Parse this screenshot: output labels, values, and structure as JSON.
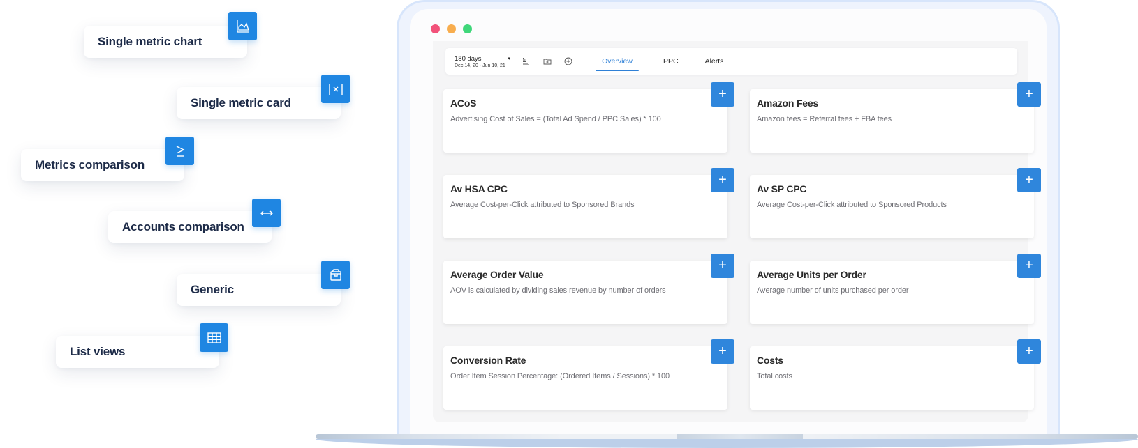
{
  "widget_types": [
    {
      "label": "Single metric chart",
      "icon": "area-chart-icon"
    },
    {
      "label": "Single metric card",
      "icon": "abs-value-icon"
    },
    {
      "label": "Metrics comparison",
      "icon": "greater-equal-icon"
    },
    {
      "label": "Accounts comparison",
      "icon": "double-arrow-icon"
    },
    {
      "label": "Generic",
      "icon": "box-icon"
    },
    {
      "label": "List views",
      "icon": "table-grid-icon"
    }
  ],
  "window": {
    "traffic_lights": [
      "#f2527a",
      "#f8ad4e",
      "#3fd77a"
    ]
  },
  "toolbar": {
    "date_range": {
      "label": "180 days",
      "sub": "Dec 14, 20 - Jun 10, 21",
      "caret": "▾"
    },
    "icons": [
      "bar-sort-icon",
      "folder-add-icon",
      "add-circle-icon"
    ],
    "tabs": [
      {
        "label": "Overview",
        "active": true
      },
      {
        "label": "PPC",
        "active": false
      },
      {
        "label": "Alerts",
        "active": false
      }
    ]
  },
  "metrics": [
    {
      "title": "ACoS",
      "description": "Advertising Cost of Sales = (Total Ad Spend / PPC Sales) * 100"
    },
    {
      "title": "Amazon Fees",
      "description": "Amazon fees = Referral fees + FBA fees"
    },
    {
      "title": "Av HSA CPC",
      "description": "Average Cost-per-Click attributed to Sponsored Brands"
    },
    {
      "title": "Av SP CPC",
      "description": "Average Cost-per-Click attributed to Sponsored Products"
    },
    {
      "title": "Average Order Value",
      "description": "AOV is calculated by dividing sales revenue by number of orders"
    },
    {
      "title": "Average Units per Order",
      "description": "Average number of units purchased per order"
    },
    {
      "title": "Conversion Rate",
      "description": "Order Item Session Percentage: (Ordered Items / Sessions) * 100"
    },
    {
      "title": "Costs",
      "description": "Total costs"
    }
  ],
  "add_button_label": "+",
  "colors": {
    "accent": "#1f86e2",
    "tab_active": "#2f80d6",
    "chip_text": "#1c2a47"
  }
}
